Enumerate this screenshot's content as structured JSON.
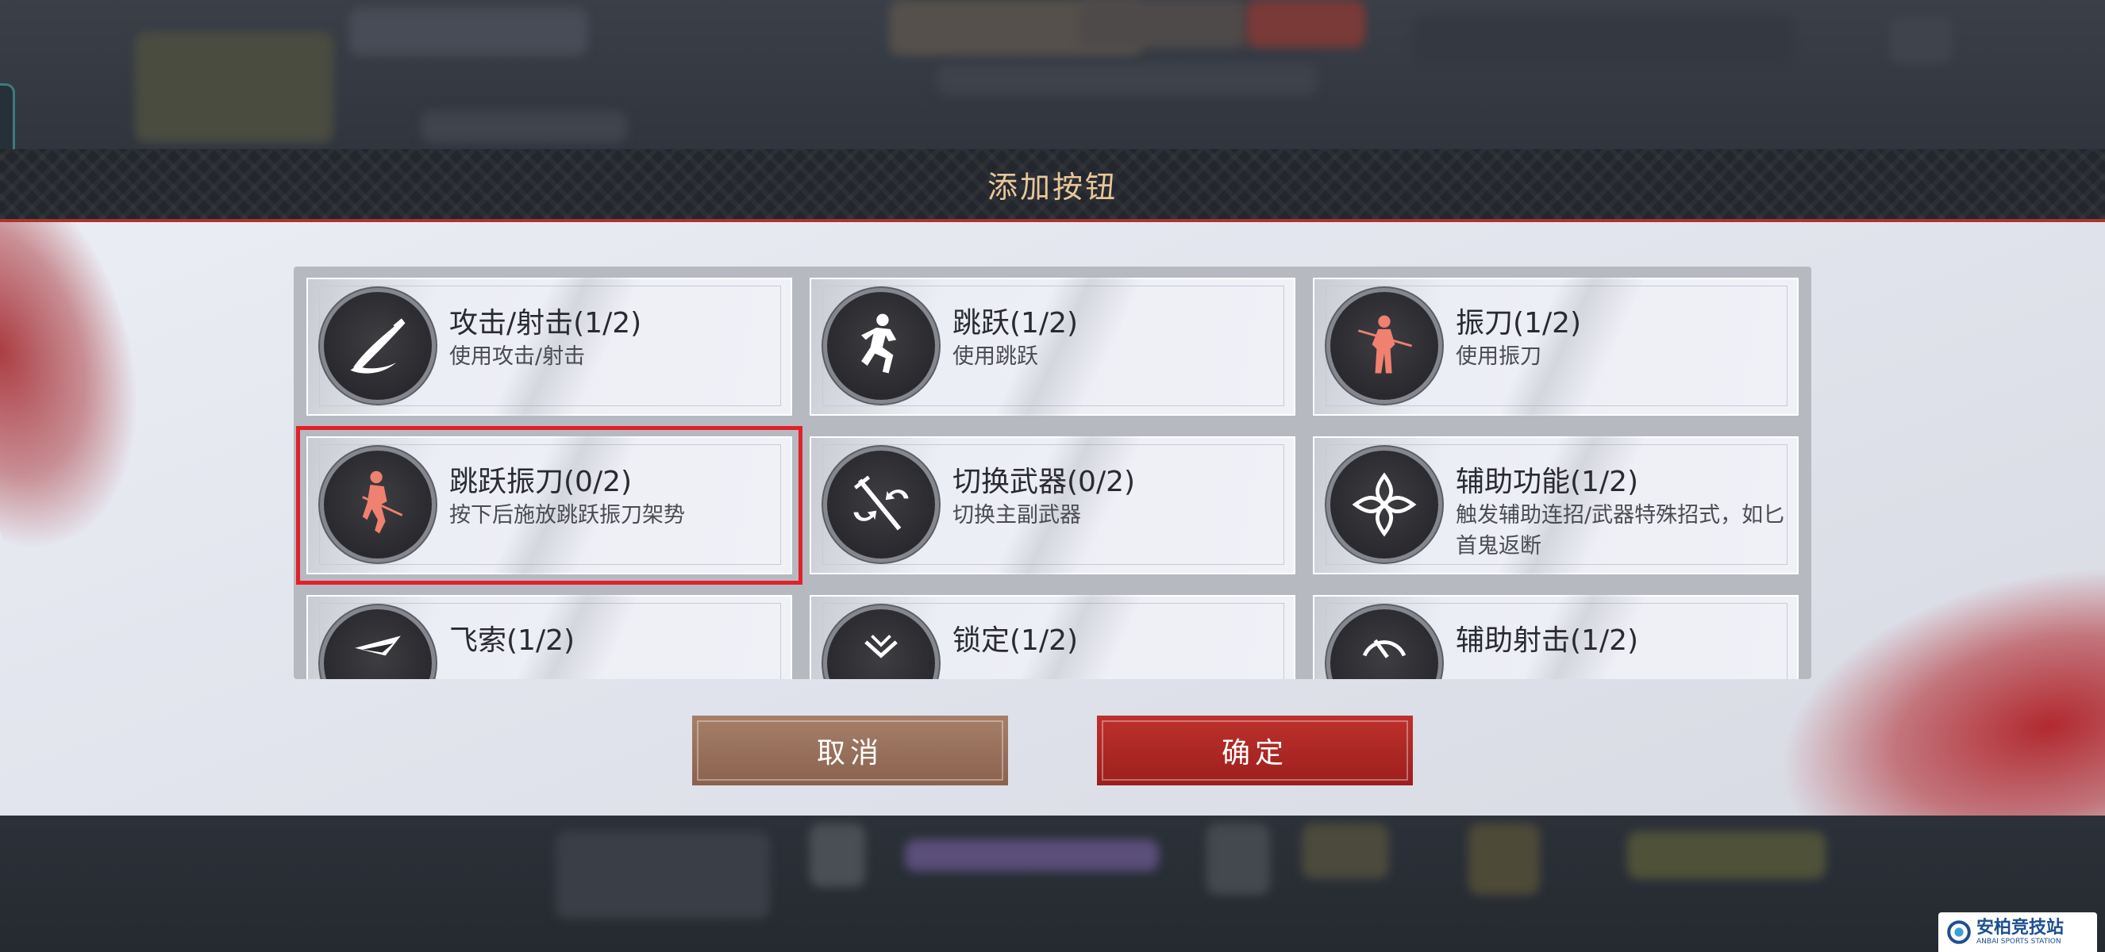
{
  "dialog": {
    "title": "添加按钮"
  },
  "cards": [
    {
      "name": "攻击/射击(1/2)",
      "desc": "使用攻击/射击",
      "icon": "sword-slash-icon",
      "icon_color": "#ffffff"
    },
    {
      "name": "跳跃(1/2)",
      "desc": "使用跳跃",
      "icon": "jump-figure-icon",
      "icon_color": "#ffffff"
    },
    {
      "name": "振刀(1/2)",
      "desc": "使用振刀",
      "icon": "parry-figure-icon",
      "icon_color": "#f08070"
    },
    {
      "name": "跳跃振刀(0/2)",
      "desc": "按下后施放跳跃振刀架势",
      "icon": "jump-parry-figure-icon",
      "icon_color": "#f08070",
      "selected": true
    },
    {
      "name": "切换武器(0/2)",
      "desc": "切换主副武器",
      "icon": "swap-weapon-icon",
      "icon_color": "#ffffff"
    },
    {
      "name": "辅助功能(1/2)",
      "desc": "触发辅助连招/武器特殊招式，如匕首鬼返断",
      "icon": "flower-emblem-icon",
      "icon_color": "#ffffff"
    },
    {
      "name": "飞索(1/2)",
      "desc": "",
      "icon": "grapple-hook-icon",
      "icon_color": "#ffffff"
    },
    {
      "name": "锁定(1/2)",
      "desc": "",
      "icon": "lock-on-icon",
      "icon_color": "#ffffff"
    },
    {
      "name": "辅助射击(1/2)",
      "desc": "",
      "icon": "aim-assist-icon",
      "icon_color": "#ffffff"
    }
  ],
  "buttons": {
    "cancel": "取消",
    "confirm": "确定"
  },
  "watermark": {
    "main": "安柏竞技站",
    "sub": "ANBAI SPORTS STATION"
  },
  "colors": {
    "accent_red": "#e0202a",
    "title_gold": "#e8c79a",
    "confirm_red": "#be312c",
    "cancel_brown": "#a67f6a"
  }
}
